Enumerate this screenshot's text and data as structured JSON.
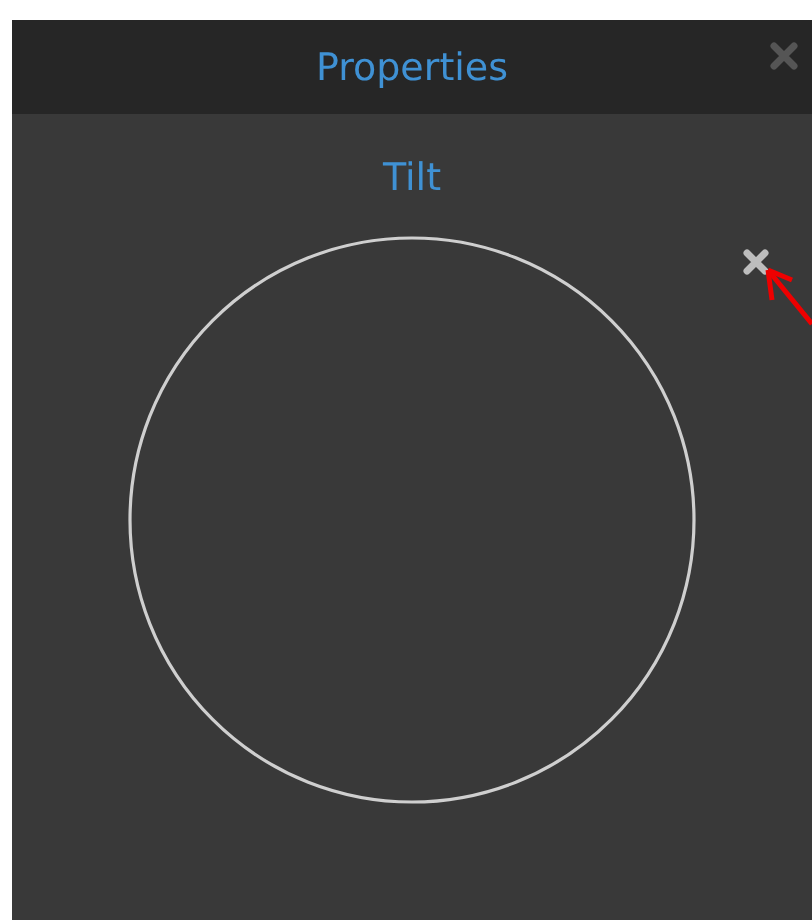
{
  "panel": {
    "title": "Properties"
  },
  "tilt": {
    "label": "Tilt"
  }
}
